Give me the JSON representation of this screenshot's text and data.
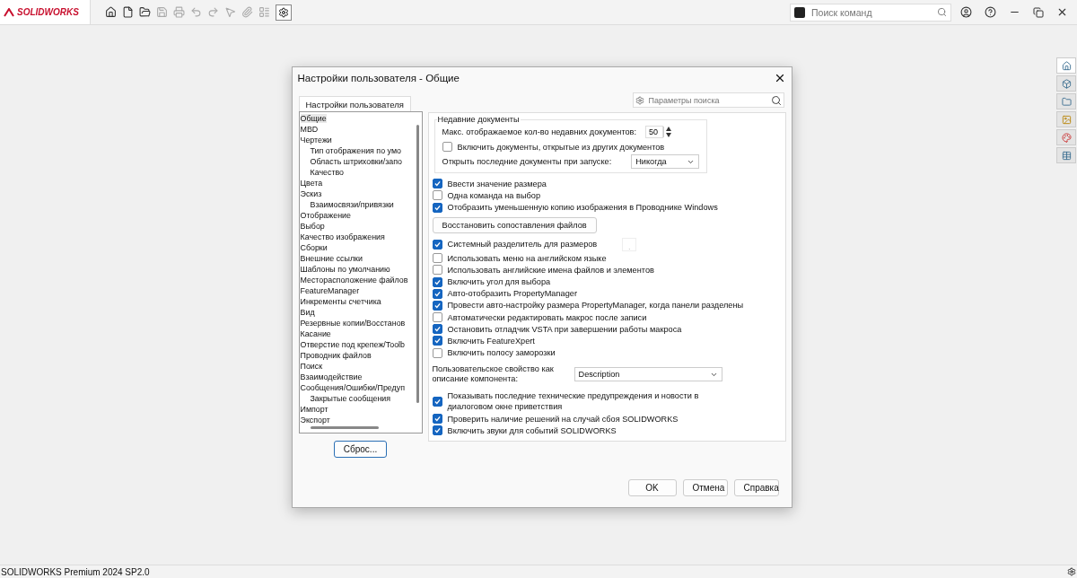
{
  "app": {
    "brand": "SOLIDWORKS",
    "search": {
      "placeholder": "Поиск команд"
    }
  },
  "dialog": {
    "title": "Настройки пользователя - Общие",
    "tab": {
      "label": "Настройки пользователя",
      "selected": true
    },
    "search": {
      "placeholder": "Параметры поиска"
    },
    "tree": [
      {
        "label": "Общие",
        "selected": true
      },
      {
        "label": "MBD",
        "selected": false
      },
      {
        "label": "Чертежи",
        "selected": false,
        "children": [
          {
            "label": "Тип отображения по умо",
            "selected": false
          },
          {
            "label": "Область штриховки/запо",
            "selected": false
          },
          {
            "label": "Качество",
            "selected": false
          }
        ]
      },
      {
        "label": "Цвета",
        "selected": false
      },
      {
        "label": "Эскиз",
        "selected": false,
        "children": [
          {
            "label": "Взаимосвязи/привязки",
            "selected": false
          }
        ]
      },
      {
        "label": "Отображение",
        "selected": false
      },
      {
        "label": "Выбор",
        "selected": false
      },
      {
        "label": "Качество изображения",
        "selected": false
      },
      {
        "label": "Сборки",
        "selected": false
      },
      {
        "label": "Внешние ссылки",
        "selected": false
      },
      {
        "label": "Шаблоны по умолчанию",
        "selected": false
      },
      {
        "label": "Месторасположение файлов",
        "selected": false
      },
      {
        "label": "FeatureManager",
        "selected": false
      },
      {
        "label": "Инкременты счетчика",
        "selected": false
      },
      {
        "label": "Вид",
        "selected": false
      },
      {
        "label": "Резервные копии/Восстанов",
        "selected": false
      },
      {
        "label": "Касание",
        "selected": false
      },
      {
        "label": "Отверстие под крепеж/Toolb",
        "selected": false
      },
      {
        "label": "Проводник файлов",
        "selected": false
      },
      {
        "label": "Поиск",
        "selected": false
      },
      {
        "label": "Взаимодействие",
        "selected": false
      },
      {
        "label": "Сообщения/Ошибки/Предуп",
        "selected": false,
        "children": [
          {
            "label": "Закрытые сообщения",
            "selected": false
          }
        ]
      },
      {
        "label": "Импорт",
        "selected": false
      },
      {
        "label": "Экспорт",
        "selected": false
      }
    ],
    "reset": "Сброс...",
    "recent": {
      "title": "Недавние документы",
      "max_label": "Макс. отображаемое кол-во недавних документов:",
      "max_value": "50",
      "include": {
        "label": "Включить документы, открытые из других документов",
        "checked": false
      },
      "open_label": "Открыть последние документы при запуске:",
      "open_value": "Никогда"
    },
    "options": [
      {
        "kind": "checkbox",
        "label": "Ввести значение размера",
        "checked": true
      },
      {
        "kind": "checkbox",
        "label": "Одна команда на выбор",
        "checked": false
      },
      {
        "kind": "checkbox",
        "label": "Отобразить уменьшенную копию изображения в Проводнике Windows",
        "checked": true
      },
      {
        "kind": "button",
        "label": "Восстановить сопоставления файлов"
      },
      {
        "kind": "checkbox",
        "label": "Системный разделитель для размеров",
        "checked": true,
        "field": "."
      },
      {
        "kind": "checkbox",
        "label": "Использовать меню на английском языке",
        "checked": false
      },
      {
        "kind": "checkbox",
        "label": "Использовать английские имена файлов и элементов",
        "checked": false
      },
      {
        "kind": "checkbox",
        "label": "Включить угол для выбора",
        "checked": true
      },
      {
        "kind": "checkbox",
        "label": "Авто-отобразить PropertyManager",
        "checked": true
      },
      {
        "kind": "checkbox",
        "label": "Провести авто-настройку размера PropertyManager, когда панели разделены",
        "checked": true
      },
      {
        "kind": "checkbox",
        "label": "Автоматически редактировать макрос после записи",
        "checked": false
      },
      {
        "kind": "checkbox",
        "label": "Остановить отладчик VSTA при завершении работы макроса",
        "checked": true
      },
      {
        "kind": "checkbox",
        "label": "Включить FeatureXpert",
        "checked": true
      },
      {
        "kind": "checkbox",
        "label": "Включить полосу заморозки",
        "checked": false
      },
      {
        "kind": "dropdown",
        "label": "Пользовательское свойство как описание компонента:",
        "value": "Description"
      },
      {
        "kind": "checkbox",
        "label": "Показывать последние технические предупреждения и новости в диалоговом окне приветствия",
        "checked": true
      },
      {
        "kind": "checkbox",
        "label": "Проверить наличие решений на случай сбоя SOLIDWORKS",
        "checked": true
      },
      {
        "kind": "checkbox",
        "label": "Включить звуки для событий SOLIDWORKS",
        "checked": true
      }
    ],
    "buttons": [
      "OK",
      "Отмена",
      "Справка"
    ]
  },
  "status_bar": "SOLIDWORKS Premium 2024 SP2.0"
}
